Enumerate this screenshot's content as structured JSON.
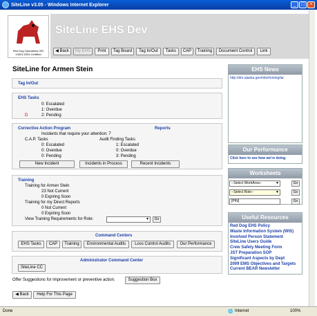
{
  "window": {
    "title": "SiteLine v3.05 - Windows Internet Explorer"
  },
  "header": {
    "logo_text": "Red Dog Operations ISO 14001:2004 Certified",
    "app_title": "SiteLine EHS Dev",
    "nav": [
      "Back",
      "My EHS",
      "Print",
      "Tag Board",
      "Tag In/Out",
      "Tasks",
      "CAP",
      "Training",
      "Document Control",
      "Link"
    ]
  },
  "main": {
    "page_title": "SiteLine for Armen Stein",
    "tag_in_out": "Tag In/Out",
    "ehs_tasks": {
      "title": "EHS Tasks",
      "rows": [
        "0: Escalated",
        "1: Overdue",
        "2: Pending"
      ],
      "marker": "D"
    },
    "cap": {
      "title": "Corrective Action Program",
      "reports": "Reports",
      "incidents": "Incidents that require your attention: 7",
      "cap_tasks_title": "C.A.P. Tasks",
      "cap_tasks": [
        "0: Escalated",
        "0: Overdue",
        "0: Pending"
      ],
      "audit_title": "Audit Finding Tasks",
      "audit_tasks": [
        "1: Escalated",
        "0: Overdue",
        "3: Pending"
      ],
      "buttons": [
        "New Incident",
        "Incidents in Process",
        "Recent Incidents"
      ]
    },
    "training": {
      "title": "Training",
      "for_user": "Training for Armen Stein",
      "user_rows": [
        "23 Not Current",
        "0 Expiring Soon"
      ],
      "direct_reports": "Training for my Direct Reports",
      "report_rows": [
        "0 Not Current",
        "0 Expiring Soon"
      ],
      "view_label": "View Training Requirements for Role:",
      "go": "Go"
    },
    "command_centers": {
      "title": "Command Centers",
      "buttons": [
        "EHS Tasks",
        "CAP",
        "Training",
        "Environmental Audits",
        "Loss Control Audits",
        "Our Performance"
      ]
    },
    "admin": {
      "title": "Administrator Command Center",
      "button": "SiteLine CC"
    },
    "suggestion_text": "Offer Suggestions for improvement or preventive action.",
    "suggestion_button": "Suggestion Box",
    "footer_buttons": [
      "Back",
      "Help For This Page"
    ]
  },
  "sidebar": {
    "news_title": "EHS News",
    "news_link": "http://dnr.alaska.gov/mlw/mining/lar",
    "perf_title": "Our Performance",
    "perf_link": "Click here to see how we're doing.",
    "worksheets_title": "Worksheets",
    "work_area": "--Select WorkArea--",
    "role": "--Select Role--",
    "pin": "[PIN]",
    "go": "Go",
    "resources_title": "Useful Resources",
    "resources": [
      "Red Dog EHS Policy",
      "Waste Information System (WIS)",
      "Involved Person Statement",
      "SiteLine Users Guide",
      "Crew Safety Meeting Form",
      "JST Preparation SOP",
      "Significant Aspects by Dept",
      "2009 EMS Objectives and Targets",
      "Current BEAR Newsletter"
    ]
  },
  "status": {
    "left": "Done",
    "zone": "Internet",
    "zoom": "100%"
  }
}
